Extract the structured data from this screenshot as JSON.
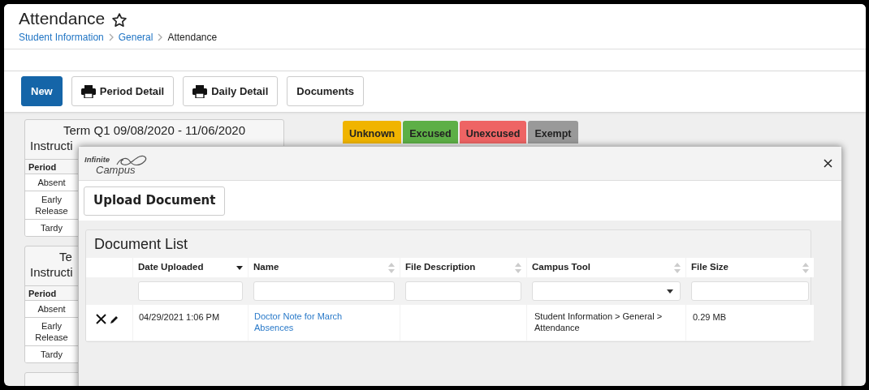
{
  "page": {
    "title": "Attendance",
    "favorite": false,
    "breadcrumb": [
      {
        "label": "Student Information",
        "link": true
      },
      {
        "label": "General",
        "link": true
      },
      {
        "label": "Attendance",
        "link": false
      }
    ]
  },
  "toolbar": [
    {
      "label": "New",
      "kind": "primary"
    },
    {
      "label": "Period Detail",
      "kind": "print"
    },
    {
      "label": "Daily Detail",
      "kind": "print"
    },
    {
      "label": "Documents",
      "kind": "plain"
    }
  ],
  "term_cards": [
    {
      "term": "Term Q1 09/08/2020 - 11/06/2020",
      "subtitle": "Instructi",
      "header": "Period",
      "rows": [
        "Absent",
        "Early Release",
        "Tardy"
      ]
    },
    {
      "term": "Te",
      "subtitle": "Instructi",
      "header": "Period",
      "rows": [
        "Absent",
        "Early Release",
        "Tardy"
      ]
    }
  ],
  "legend": [
    {
      "label": "Unknown",
      "color": "#f0b400"
    },
    {
      "label": "Excused",
      "color": "#5daf46"
    },
    {
      "label": "Unexcused",
      "color": "#ee6464"
    },
    {
      "label": "Exempt",
      "color": "#999999"
    }
  ],
  "modal": {
    "logo": {
      "top": "Infinite",
      "bottom": "Campus"
    },
    "upload_button": "Upload Document",
    "panel_title": "Document List",
    "columns": [
      {
        "label": "Date Uploaded",
        "sorted": true,
        "dropdown": false
      },
      {
        "label": "Name",
        "sorted": false,
        "dropdown": false
      },
      {
        "label": "File Description",
        "sorted": false,
        "dropdown": false
      },
      {
        "label": "Campus Tool",
        "sorted": false,
        "dropdown": true
      },
      {
        "label": "File Size",
        "sorted": false,
        "dropdown": false
      }
    ],
    "rows": [
      {
        "date_uploaded": "04/29/2021 1:06 PM",
        "name": "Doctor Note for March Absences",
        "campus_tool": "Student Information > General > Attendance",
        "file_size": "0.29 MB"
      }
    ]
  }
}
